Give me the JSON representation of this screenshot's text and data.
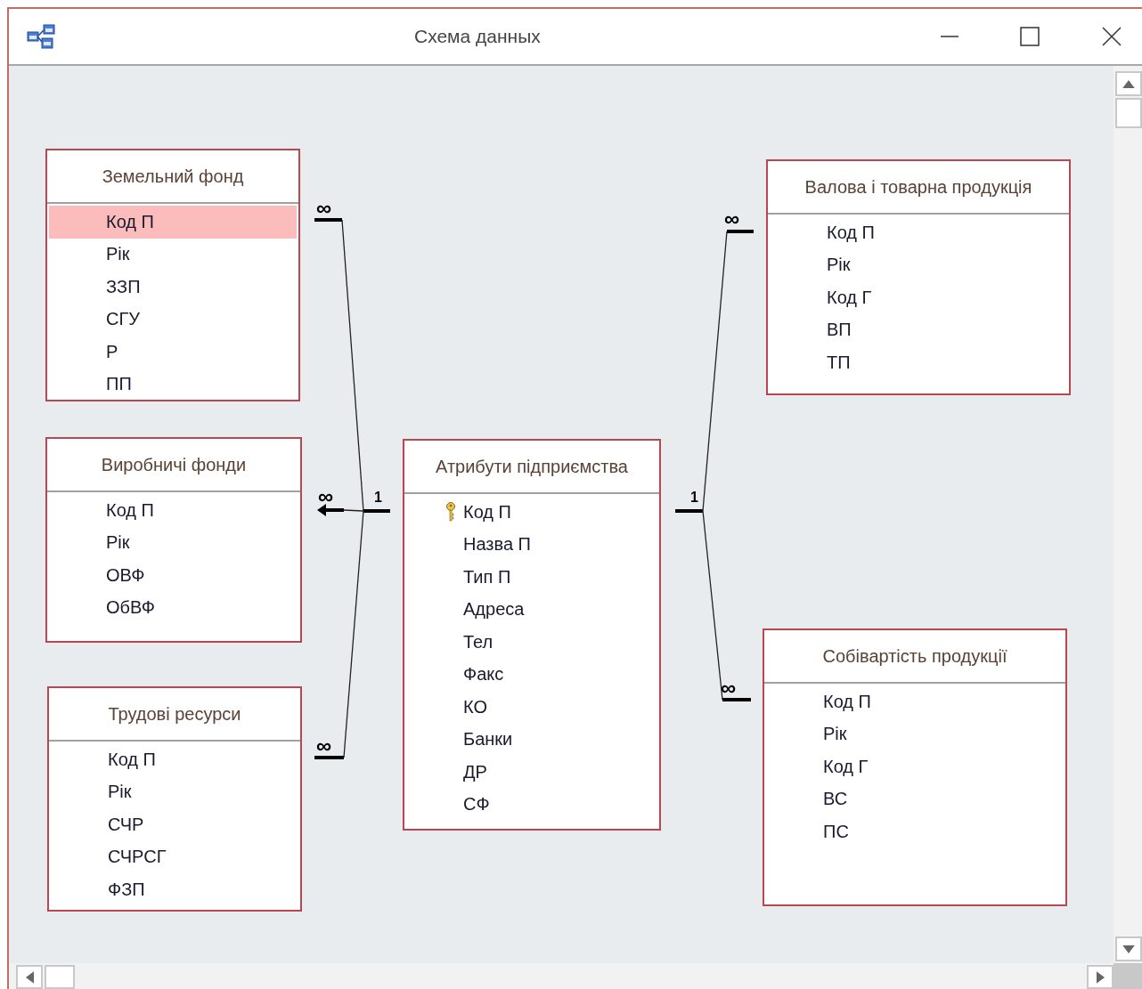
{
  "window": {
    "title": "Схема данных"
  },
  "tables": [
    {
      "title": "Земельний фонд",
      "fields": [
        {
          "name": "Код П",
          "selected": true,
          "key": false
        },
        {
          "name": "Рік",
          "selected": false,
          "key": false
        },
        {
          "name": "ЗЗП",
          "selected": false,
          "key": false
        },
        {
          "name": "СГУ",
          "selected": false,
          "key": false
        },
        {
          "name": "Р",
          "selected": false,
          "key": false
        },
        {
          "name": "ПП",
          "selected": false,
          "key": false
        }
      ]
    },
    {
      "title": "Виробничі фонди",
      "fields": [
        {
          "name": "Код П",
          "selected": false,
          "key": false
        },
        {
          "name": "Рік",
          "selected": false,
          "key": false
        },
        {
          "name": "ОВФ",
          "selected": false,
          "key": false
        },
        {
          "name": "ОбВФ",
          "selected": false,
          "key": false
        }
      ]
    },
    {
      "title": "Трудові ресурси",
      "fields": [
        {
          "name": "Код П",
          "selected": false,
          "key": false
        },
        {
          "name": "Рік",
          "selected": false,
          "key": false
        },
        {
          "name": "СЧР",
          "selected": false,
          "key": false
        },
        {
          "name": "СЧРСГ",
          "selected": false,
          "key": false
        },
        {
          "name": "ФЗП",
          "selected": false,
          "key": false
        }
      ]
    },
    {
      "title": "Атрибути підприємства",
      "fields": [
        {
          "name": "Код П",
          "selected": false,
          "key": true
        },
        {
          "name": "Назва П",
          "selected": false,
          "key": false
        },
        {
          "name": "Тип П",
          "selected": false,
          "key": false
        },
        {
          "name": "Адреса",
          "selected": false,
          "key": false
        },
        {
          "name": "Тел",
          "selected": false,
          "key": false
        },
        {
          "name": "Факс",
          "selected": false,
          "key": false
        },
        {
          "name": "КО",
          "selected": false,
          "key": false
        },
        {
          "name": "Банки",
          "selected": false,
          "key": false
        },
        {
          "name": "ДР",
          "selected": false,
          "key": false
        },
        {
          "name": "СФ",
          "selected": false,
          "key": false
        }
      ]
    },
    {
      "title": "Валова і товарна продукція",
      "fields": [
        {
          "name": "Код П",
          "selected": false,
          "key": false
        },
        {
          "name": "Рік",
          "selected": false,
          "key": false
        },
        {
          "name": "Код Г",
          "selected": false,
          "key": false
        },
        {
          "name": "ВП",
          "selected": false,
          "key": false
        },
        {
          "name": "ТП",
          "selected": false,
          "key": false
        }
      ]
    },
    {
      "title": "Собівартість продукції",
      "fields": [
        {
          "name": "Код П",
          "selected": false,
          "key": false
        },
        {
          "name": "Рік",
          "selected": false,
          "key": false
        },
        {
          "name": "Код Г",
          "selected": false,
          "key": false
        },
        {
          "name": "ВС",
          "selected": false,
          "key": false
        },
        {
          "name": "ПС",
          "selected": false,
          "key": false
        }
      ]
    }
  ],
  "junctions": [
    {
      "one_label": "1",
      "links": [
        {
          "many_label": "∞",
          "arrow": false
        },
        {
          "many_label": "∞",
          "arrow": true
        },
        {
          "many_label": "∞",
          "arrow": false
        }
      ]
    },
    {
      "one_label": "1",
      "links": [
        {
          "many_label": "∞",
          "arrow": false
        },
        {
          "many_label": "∞",
          "arrow": false
        }
      ]
    }
  ]
}
